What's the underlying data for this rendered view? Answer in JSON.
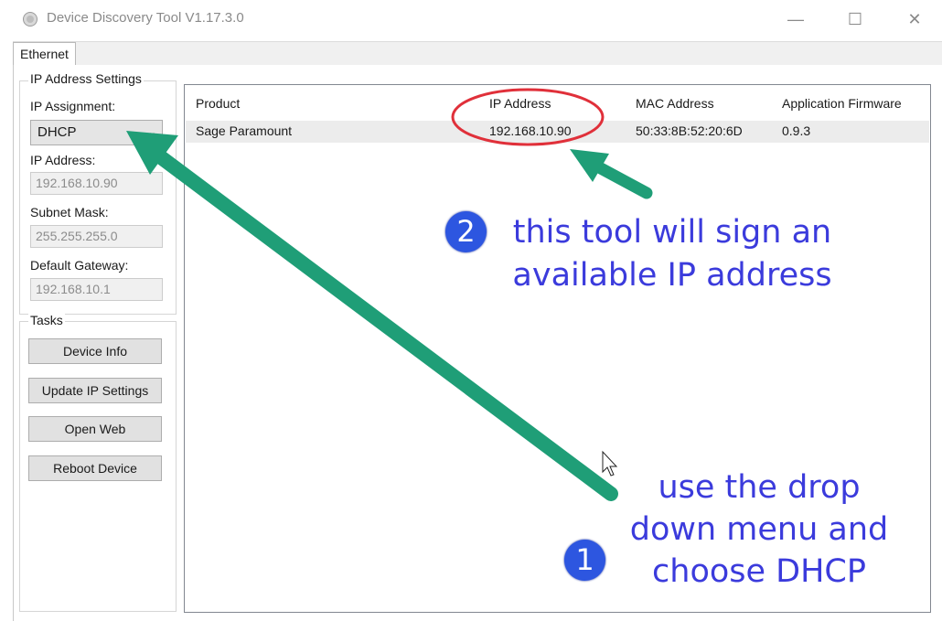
{
  "window": {
    "title": "Device Discovery Tool V1.17.3.0",
    "minimize_icon": "minimize-icon",
    "maximize_icon": "maximize-icon",
    "close_icon": "close-icon"
  },
  "tabs": [
    {
      "label": "Ethernet",
      "selected": true
    }
  ],
  "ip_settings": {
    "group_title": "IP Address Settings",
    "assignment_label": "IP Assignment:",
    "assignment_value": "DHCP",
    "ip_label": "IP Address:",
    "ip_value": "192.168.10.90",
    "subnet_label": "Subnet Mask:",
    "subnet_value": "255.255.255.0",
    "gateway_label": "Default Gateway:",
    "gateway_value": "192.168.10.1"
  },
  "tasks": {
    "group_title": "Tasks",
    "device_info": "Device Info",
    "update_ip": "Update IP Settings",
    "open_web": "Open Web",
    "reboot": "Reboot Device"
  },
  "device_list": {
    "columns": [
      "Product",
      "IP Address",
      "MAC Address",
      "Application Firmware"
    ],
    "rows": [
      {
        "product": "Sage Paramount",
        "ip": "192.168.10.90",
        "mac": "50:33:8B:52:20:6D",
        "firmware": "0.9.3"
      }
    ]
  },
  "annotations": {
    "step1_number": "1",
    "step1_line1": "use the drop",
    "step1_line2": "down menu and",
    "step1_line3": "choose DHCP",
    "step2_number": "2",
    "step2_line1": "this tool will sign an",
    "step2_line2": "available IP address",
    "text_color": "#3b3bdc",
    "badge_color": "#2d56e0",
    "arrow_color": "#1f9e77",
    "circle_color": "#e0303a"
  }
}
